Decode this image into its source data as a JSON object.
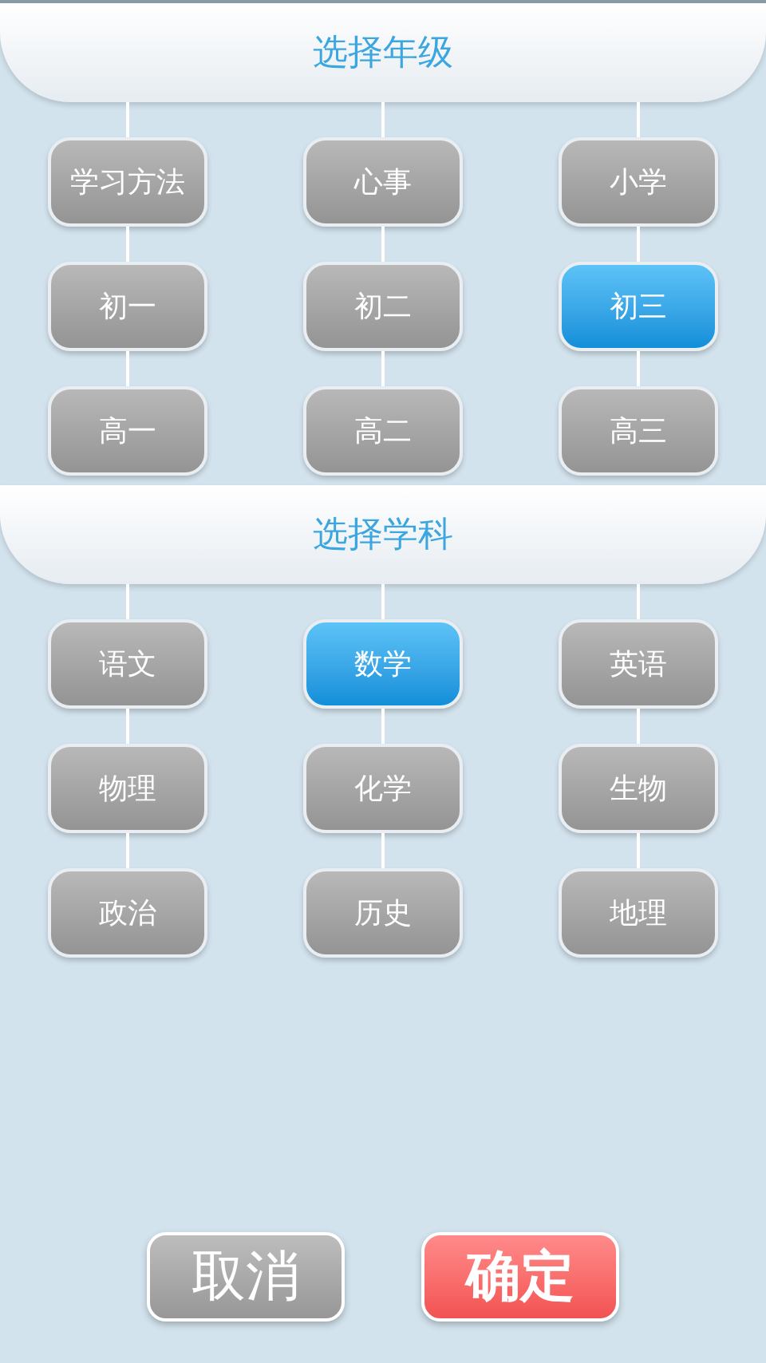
{
  "sections": [
    {
      "title": "选择年级",
      "options": [
        {
          "label": "学习方法",
          "selected": false
        },
        {
          "label": "心事",
          "selected": false
        },
        {
          "label": "小学",
          "selected": false
        },
        {
          "label": "初一",
          "selected": false
        },
        {
          "label": "初二",
          "selected": false
        },
        {
          "label": "初三",
          "selected": true
        },
        {
          "label": "高一",
          "selected": false
        },
        {
          "label": "高二",
          "selected": false
        },
        {
          "label": "高三",
          "selected": false
        }
      ]
    },
    {
      "title": "选择学科",
      "options": [
        {
          "label": "语文",
          "selected": false
        },
        {
          "label": "数学",
          "selected": true
        },
        {
          "label": "英语",
          "selected": false
        },
        {
          "label": "物理",
          "selected": false
        },
        {
          "label": "化学",
          "selected": false
        },
        {
          "label": "生物",
          "selected": false
        },
        {
          "label": "政治",
          "selected": false
        },
        {
          "label": "历史",
          "selected": false
        },
        {
          "label": "地理",
          "selected": false
        }
      ]
    }
  ],
  "actions": [
    {
      "label": "取消",
      "kind": "cancel"
    },
    {
      "label": "确定",
      "kind": "confirm"
    }
  ]
}
